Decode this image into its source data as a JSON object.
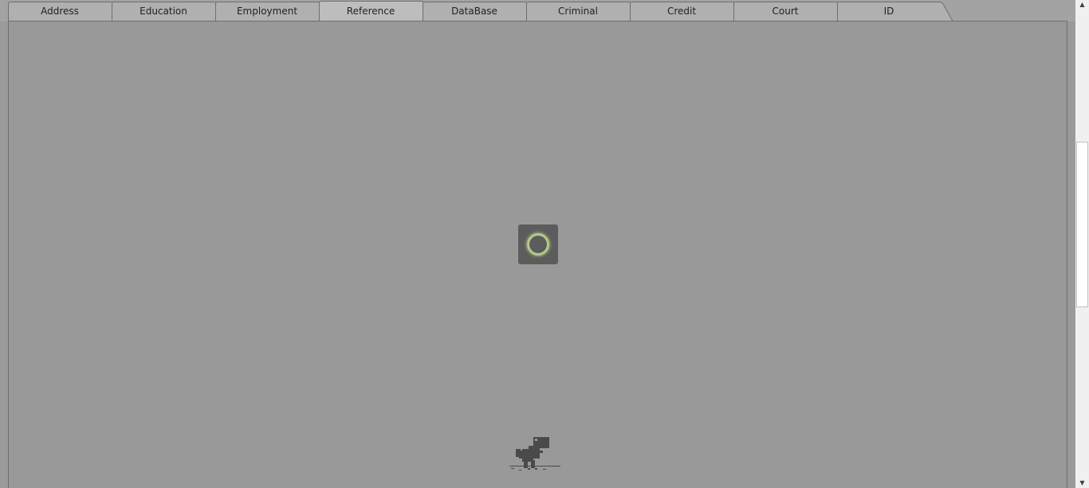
{
  "tabs": [
    {
      "label": "Address"
    },
    {
      "label": "Education"
    },
    {
      "label": "Employment"
    },
    {
      "label": "Reference",
      "active": true
    },
    {
      "label": "DataBase"
    },
    {
      "label": "Criminal"
    },
    {
      "label": "Credit"
    },
    {
      "label": "Court"
    },
    {
      "label": "ID"
    }
  ],
  "colors": {
    "tab_bg": "#a3a3a3",
    "active_tab_bg": "#bdbdbd",
    "content_bg": "#999999",
    "spinner_bg": "#5c5c5c",
    "spinner_ring": "#b5c98a"
  },
  "icons": {
    "loading": "loading-spinner-icon",
    "dino": "offline-dino-icon",
    "scroll_up": "▲",
    "scroll_down": "▼"
  }
}
